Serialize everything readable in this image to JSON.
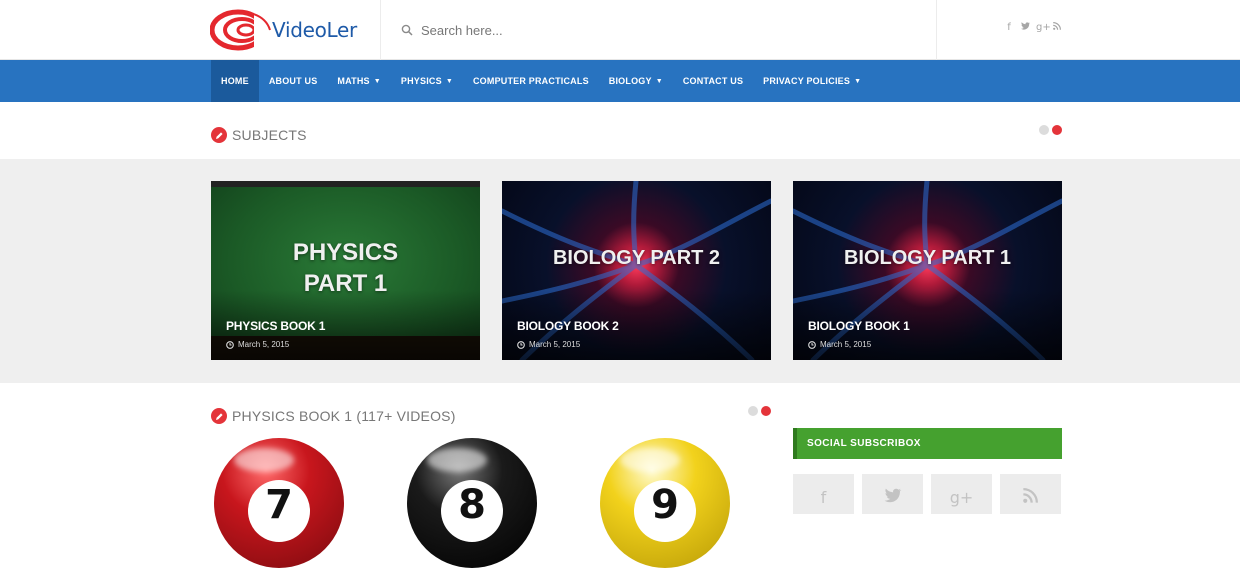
{
  "brand": {
    "name": "VideoLer"
  },
  "search": {
    "placeholder": "Search here..."
  },
  "header_social": [
    "f",
    "t",
    "g+",
    "rss"
  ],
  "nav": {
    "items": [
      {
        "label": "HOME",
        "active": true,
        "dropdown": false
      },
      {
        "label": "ABOUT US",
        "active": false,
        "dropdown": false
      },
      {
        "label": "MATHS",
        "active": false,
        "dropdown": true
      },
      {
        "label": "PHYSICS",
        "active": false,
        "dropdown": true
      },
      {
        "label": "COMPUTER PRACTICALS",
        "active": false,
        "dropdown": false
      },
      {
        "label": "BIOLOGY",
        "active": false,
        "dropdown": true
      },
      {
        "label": "CONTACT US",
        "active": false,
        "dropdown": false
      },
      {
        "label": "PRIVACY POLICIES",
        "active": false,
        "dropdown": true
      }
    ]
  },
  "subjects": {
    "title": "SUBJECTS",
    "cards": [
      {
        "image_text": [
          "PHYSICS",
          "PART 1"
        ],
        "title": "PHYSICS BOOK 1",
        "date": "March 5, 2015"
      },
      {
        "image_text": [
          "BIOLOGY PART 2"
        ],
        "title": "BIOLOGY BOOK 2",
        "date": "March 5, 2015"
      },
      {
        "image_text": [
          "BIOLOGY PART 1"
        ],
        "title": "BIOLOGY BOOK 1",
        "date": "March 5, 2015"
      }
    ]
  },
  "physics_book": {
    "title": "PHYSICS BOOK 1 (117+ VIDEOS)",
    "balls": [
      {
        "number": "7",
        "color": "#c8161d"
      },
      {
        "number": "8",
        "color": "#1a1a1a"
      },
      {
        "number": "9",
        "color": "#f2d21c"
      }
    ]
  },
  "sidebar": {
    "widget_title": "SOCIAL SUBSCRIBOX",
    "tiles": [
      "f",
      "twitter",
      "g+",
      "rss"
    ]
  },
  "colors": {
    "accent_red": "#e4343a",
    "nav_blue": "#2873c0",
    "widget_green": "#45a12f"
  }
}
